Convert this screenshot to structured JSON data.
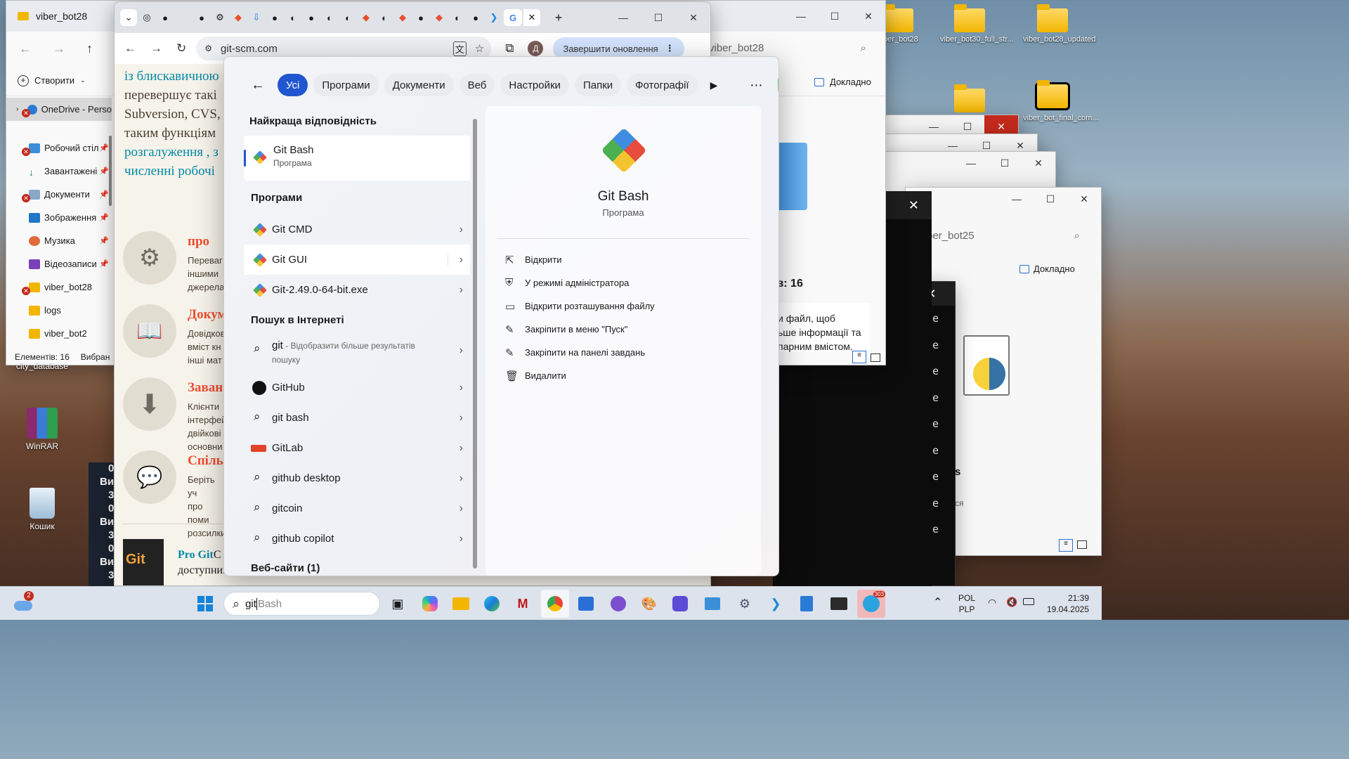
{
  "desktop": {
    "icons_right": [
      "viber_bot28",
      "viber_bot30_full_str...",
      "viber_bot28_updated",
      "",
      "viber_bot_final_com..."
    ],
    "icons_left": [
      "city_database",
      "WinRAR",
      "Кошик"
    ]
  },
  "explorer": {
    "tab_title": "viber_bot28",
    "new_button": "Створити",
    "sidebar": [
      {
        "label": "OneDrive - Perso",
        "err": true
      },
      {
        "label": "Робочий стіл",
        "err": true,
        "pin": true
      },
      {
        "label": "Завантажені",
        "err": false,
        "pin": true
      },
      {
        "label": "Документи",
        "err": true,
        "pin": true
      },
      {
        "label": "Зображення",
        "err": false,
        "pin": true
      },
      {
        "label": "Музика",
        "err": false,
        "pin": true
      },
      {
        "label": "Відеозаписи",
        "err": false,
        "pin": true
      },
      {
        "label": "viber_bot28",
        "err": true
      },
      {
        "label": "logs",
        "err": false
      },
      {
        "label": "viber_bot2",
        "err": false
      }
    ],
    "status_count": "Елементів: 16",
    "status_selected": "Вибран",
    "search_placeholder": "viber_bot28",
    "details": "Докладно",
    "items_count": "ів: 16",
    "hint": [
      "и файл, щоб",
      "ьше інформації та",
      "парним вмістом."
    ]
  },
  "explorer2": {
    "search": "per_bot25",
    "details": "Докладно",
    "text_s": "s",
    "text_sia": "ся"
  },
  "chrome": {
    "url": "git-scm.com",
    "update_button": "Завершити оновлення",
    "profile_letter": "Д",
    "page_text_lines": [
      "із блискавичною",
      "перевершує такі",
      "Subversion, CVS,",
      "таким функціям",
      "розгалуження , з",
      "численні робочі"
    ],
    "features": [
      {
        "title": "про",
        "body": [
          "Переваг",
          "іншими",
          "джерела"
        ]
      },
      {
        "title": "Докум",
        "body": [
          "Довідков",
          "вміст кн",
          "інші мат"
        ]
      },
      {
        "title": "Заван",
        "body": [
          "Клієнти",
          "інтерфей",
          "двійкові",
          "основни"
        ]
      },
      {
        "title": "Спіль",
        "body": [
          "Беріть уч",
          "про поми",
          "розсилки"
        ]
      }
    ],
    "progit": "Pro Git",
    "progit_rest": "C",
    "progit_line2": "доступний"
  },
  "search": {
    "filters": [
      "Усі",
      "Програми",
      "Документи",
      "Веб",
      "Настройки",
      "Папки",
      "Фотографії"
    ],
    "best_match_heading": "Найкраща відповідність",
    "best": {
      "name": "Git Bash",
      "type": "Програма"
    },
    "apps_heading": "Програми",
    "apps": [
      "Git CMD",
      "Git GUI",
      "Git-2.49.0-64-bit.exe"
    ],
    "web_heading": "Пошук в Інтернеті",
    "web": [
      {
        "term": "git",
        "sub": " - Відобразити більше результатів",
        "sub2": "пошуку",
        "icon": "search-icon"
      },
      {
        "term": "GitHub",
        "icon": "github-icon"
      },
      {
        "term": "git bash",
        "icon": "search-icon"
      },
      {
        "term": "GitLab",
        "icon": "gitlab-icon"
      },
      {
        "term": "github desktop",
        "icon": "search-icon"
      },
      {
        "term": "gitcoin",
        "icon": "search-icon"
      },
      {
        "term": "github copilot",
        "icon": "search-icon"
      }
    ],
    "sites_heading": "Веб-сайти (1)",
    "detail": {
      "name": "Git Bash",
      "type": "Програма",
      "actions": [
        "Відкрити",
        "У режимі адміністратора",
        "Відкрити розташування файлу",
        "Закріпити в меню \"Пуск\"",
        "Закріпити на панелі завдань",
        "Видалити"
      ]
    }
  },
  "terminal": {
    "letters": [
      "e",
      "e",
      "e",
      "e",
      "e",
      "e",
      "e",
      "e",
      "e"
    ]
  },
  "checkbox_list": [
    "0",
    "Ви",
    "3",
    "0",
    "Ви",
    "3",
    "0",
    "Ви",
    "3"
  ],
  "taskbar": {
    "weather_badge": "2",
    "search_typed": "git",
    "search_suggest": "Bash",
    "telegram_badge": "303",
    "lang1": "POL",
    "lang2": "PLP",
    "time": "21:39",
    "date": "19.04.2025"
  }
}
